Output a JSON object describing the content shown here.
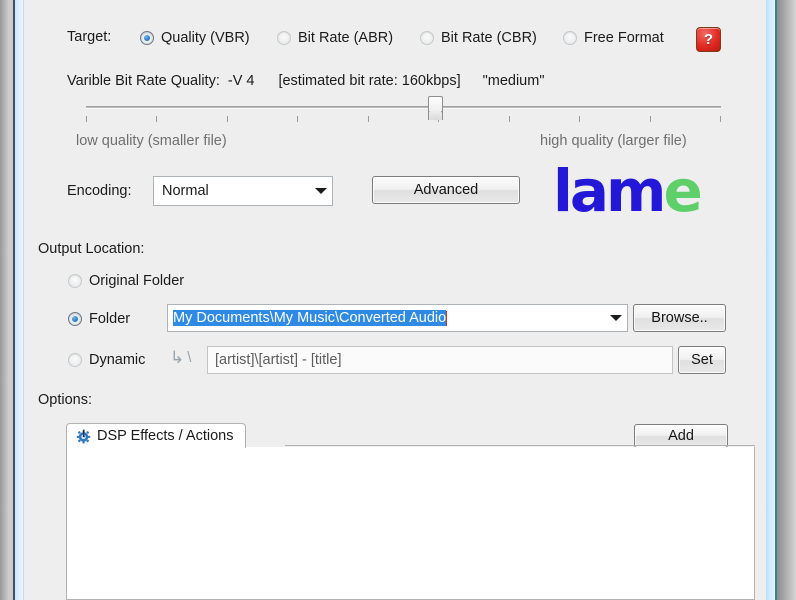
{
  "target_row": {
    "label": "Target:",
    "options": [
      {
        "label": "Quality (VBR)",
        "selected": true
      },
      {
        "label": "Bit Rate (ABR)",
        "selected": false
      },
      {
        "label": "Bit Rate (CBR)",
        "selected": false
      },
      {
        "label": "Free Format",
        "selected": false
      }
    ],
    "help_icon_glyph": "?",
    "help_icon_color": "#e22a22"
  },
  "quality": {
    "label": "Varible Bit Rate Quality:",
    "value": "-V 4",
    "estimate": "[estimated bit rate: 160kbps]",
    "preset": "\"medium\"",
    "slider": {
      "position_percent": 55,
      "tick_count": 10,
      "left_label": "low quality (smaller file)",
      "right_label": "high quality (larger file)"
    }
  },
  "encoding": {
    "label": "Encoding:",
    "value": "Normal",
    "advanced_button": "Advanced"
  },
  "logo": {
    "part1": "lam",
    "part2": "e",
    "color1": "#2318d8",
    "color2": "#5fcf6a"
  },
  "output_location": {
    "heading": "Output Location:",
    "original_folder": {
      "label": "Original Folder",
      "selected": false
    },
    "folder": {
      "label": "Folder",
      "selected": true,
      "value": "My Documents\\My Music\\Converted Audio",
      "selected_text": true,
      "browse_button": "Browse.."
    },
    "dynamic": {
      "label": "Dynamic",
      "selected": false,
      "hook_glyph": "↳",
      "separator": "\\",
      "value": "[artist]\\[artist] - [title]",
      "set_button": "Set"
    }
  },
  "options": {
    "heading": "Options:",
    "tabs": [
      {
        "label": "DSP Effects / Actions",
        "icon": "gear-icon",
        "active": true
      }
    ],
    "add_button": "Add",
    "list_items": []
  }
}
